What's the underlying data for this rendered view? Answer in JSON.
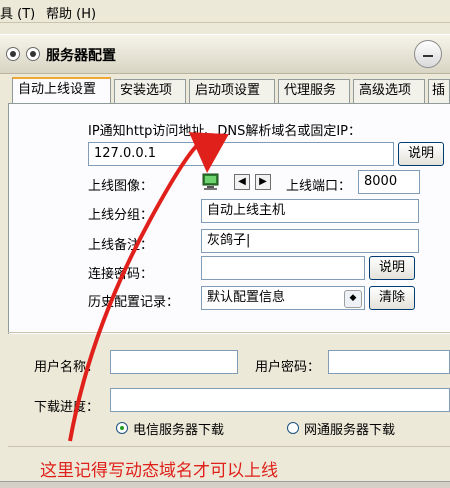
{
  "menu": {
    "tool": "具 (T)",
    "help": "帮助 (H)"
  },
  "window": {
    "title": "服务器配置"
  },
  "tabs": [
    {
      "label": "自动上线设置",
      "active": true
    },
    {
      "label": "安装选项"
    },
    {
      "label": "启动项设置"
    },
    {
      "label": "代理服务"
    },
    {
      "label": "高级选项"
    },
    {
      "label": "插"
    }
  ],
  "form": {
    "ip_note": "IP通知http访问地址、DNS解析域名或固定IP：",
    "ip_value": "127.0.0.1",
    "explain_label": "说明",
    "icon_label": "上线图像：",
    "port_label": "上线端口：",
    "port_value": "8000",
    "group_label": "上线分组：",
    "group_value": "自动上线主机",
    "remark_label": "上线备注：",
    "remark_value": "灰鸽子|",
    "password_label": "连接密码：",
    "password_value": "",
    "explain2_label": "说明",
    "history_label": "历史配置记录：",
    "history_value": "默认配置信息",
    "clear_label": "清除"
  },
  "download": {
    "username_label": "用户名称：",
    "username_value": "",
    "userpass_label": "用户密码：",
    "userpass_value": "",
    "progress_label": "下载进度：",
    "radio_telecom": "电信服务器下载",
    "radio_netcom": "网通服务器下载",
    "selected": "电信服务器下载"
  },
  "annotation": "这里记得写动态域名才可以上线",
  "colors": {
    "annotation": "#e0201a",
    "tab_highlight": "#f1a733"
  },
  "icons": [
    "computer-icon",
    "arrow-left-icon",
    "arrow-right-icon",
    "dropdown-icon"
  ]
}
